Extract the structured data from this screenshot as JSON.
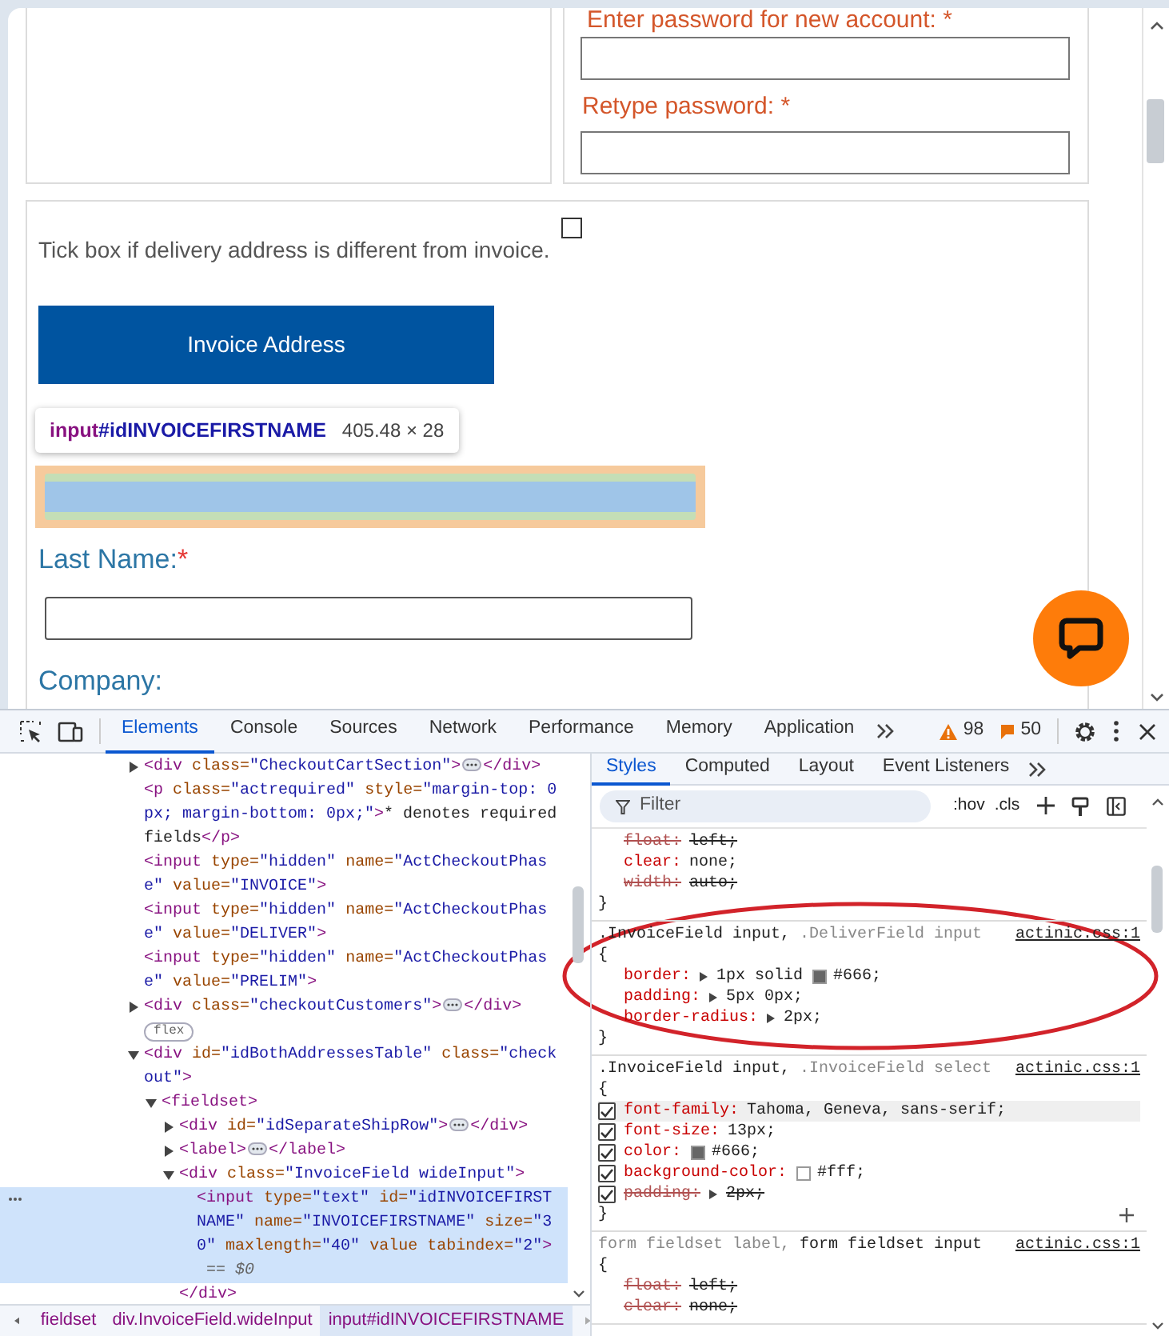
{
  "account_panel": {
    "fields": [
      {
        "label": "Enter password for new account: *"
      },
      {
        "label": "Retype password: *"
      }
    ]
  },
  "address_panel": {
    "separate_delivery": {
      "label": "Tick box if delivery address is different from invoice.",
      "checked": false
    },
    "invoice_button": "Invoice Address",
    "inspect_tooltip": {
      "tag": "input",
      "id": "#idINVOICEFIRSTNAME",
      "size": "405.48 × 28"
    },
    "fields": [
      {
        "kind": "inspected"
      },
      {
        "kind": "text",
        "label": "Last Name:",
        "required_mark": "*"
      },
      {
        "kind": "label",
        "label": "Company:"
      }
    ]
  },
  "devtools": {
    "tabs": [
      {
        "label": "Elements",
        "selected": true
      },
      {
        "label": "Console",
        "selected": false
      },
      {
        "label": "Sources",
        "selected": false
      },
      {
        "label": "Network",
        "selected": false
      },
      {
        "label": "Performance",
        "selected": false
      },
      {
        "label": "Memory",
        "selected": false
      },
      {
        "label": "Application",
        "selected": false
      }
    ],
    "warnings": "98",
    "messages": "50",
    "dom_tree": [
      {
        "text": "<div class=\"CheckoutCartSection\">",
        "close": "</div>",
        "expanded": false,
        "selected": false
      },
      {
        "text": "<p class=\"actrequired\" style=\"margin-top: 0px; margin-bottom: 0px;\">* denotes required fields</p>",
        "selected": false
      },
      {
        "text": "<input type=\"hidden\" name=\"ActCheckoutPhase\" value=\"INVOICE\">",
        "selected": false
      },
      {
        "text": "<input type=\"hidden\" name=\"ActCheckoutPhase\" value=\"DELIVER\">",
        "selected": false
      },
      {
        "text": "<input type=\"hidden\" name=\"ActCheckoutPhase\" value=\"PRELIM\">",
        "selected": false
      },
      {
        "text": "<div class=\"checkoutCustomers\">",
        "close": "</div>",
        "expanded": false,
        "badge": "flex",
        "selected": false
      },
      {
        "text": "<div id=\"idBothAddressesTable\" class=\"checkout\">",
        "expanded": true,
        "selected": false,
        "children": [
          {
            "text": "<fieldset>",
            "expanded": true,
            "selected": false,
            "children": [
              {
                "text": "<div id=\"idSeparateShipRow\">",
                "close": "</div>",
                "expanded": false,
                "selected": false
              },
              {
                "text": "<label>",
                "close": "</label>",
                "expanded": false,
                "selected": false
              },
              {
                "text": "<div class=\"InvoiceField wideInput\">",
                "close": "</div>",
                "expanded": true,
                "selected": false,
                "children": [
                  {
                    "text": "<input type=\"text\" id=\"idINVOICEFIRSTNAME\" name=\"INVOICEFIRSTNAME\" size=\"30\" maxlength=\"40\" value tabindex=\"2\">",
                    "marker": "== $0",
                    "selected": true
                  }
                ]
              }
            ]
          }
        ]
      }
    ],
    "breadcrumbs": [
      {
        "label": "fieldset",
        "selected": false
      },
      {
        "label": "div.InvoiceField.wideInput",
        "selected": false
      },
      {
        "label": "input#idINVOICEFIRSTNAME",
        "selected": true
      }
    ],
    "styles": {
      "tabs": [
        {
          "label": "Styles",
          "selected": true
        },
        {
          "label": "Computed",
          "selected": false
        },
        {
          "label": "Layout",
          "selected": false
        },
        {
          "label": "Event Listeners",
          "selected": false
        }
      ],
      "filter": {
        "placeholder": "Filter"
      },
      "toggles": [
        ":hov",
        ".cls"
      ],
      "rules": [
        {
          "close_brace": "}",
          "props": [
            {
              "name": "float:",
              "value": "left;",
              "overridden": true
            },
            {
              "name": "clear:",
              "value": "none;",
              "overridden": false
            },
            {
              "name": "width:",
              "value": "auto;",
              "overridden": true
            }
          ]
        },
        {
          "selector": [
            {
              "text": ".InvoiceField input,",
              "matched": true
            },
            {
              "text": ".DeliverField input",
              "matched": false
            }
          ],
          "source": "actinic.css:1",
          "open_brace": "{",
          "close_brace": "}",
          "props": [
            {
              "name": "border:",
              "expandable": true,
              "value": "1px solid",
              "color_value": "#666;",
              "overridden": false
            },
            {
              "name": "padding:",
              "expandable": true,
              "value": "5px 0px;",
              "overridden": false
            },
            {
              "name": "border-radius:",
              "expandable": true,
              "value": "2px;",
              "overridden": false
            }
          ]
        },
        {
          "selector": [
            {
              "text": ".InvoiceField input,",
              "matched": true
            },
            {
              "text": ".InvoiceField select",
              "matched": false
            }
          ],
          "source": "actinic.css:1",
          "open_brace": "{",
          "close_brace": "}",
          "add_button": true,
          "props": [
            {
              "name": "font-family:",
              "value": "Tahoma, Geneva, sans-serif;",
              "overridden": false,
              "checked": true,
              "hovered": true
            },
            {
              "name": "font-size:",
              "value": "13px;",
              "overridden": false,
              "checked": true,
              "hovered": false
            },
            {
              "name": "color:",
              "color_value": "#666;",
              "overridden": false,
              "checked": true,
              "hovered": false
            },
            {
              "name": "background-color:",
              "color_value": "#fff;",
              "overridden": false,
              "checked": true,
              "hovered": false
            },
            {
              "name": "padding:",
              "expandable": true,
              "value": "2px;",
              "overridden": true,
              "checked": true,
              "hovered": false
            }
          ]
        },
        {
          "selector": [
            {
              "text": "form fieldset label,",
              "matched": false
            },
            {
              "text": "form fieldset input",
              "matched": true
            }
          ],
          "source": "actinic.css:1",
          "open_brace": "{",
          "props": [
            {
              "name": "float:",
              "value": "left;",
              "overridden": true
            },
            {
              "name": "clear:",
              "value": "none;",
              "overridden": true
            }
          ]
        }
      ]
    }
  }
}
